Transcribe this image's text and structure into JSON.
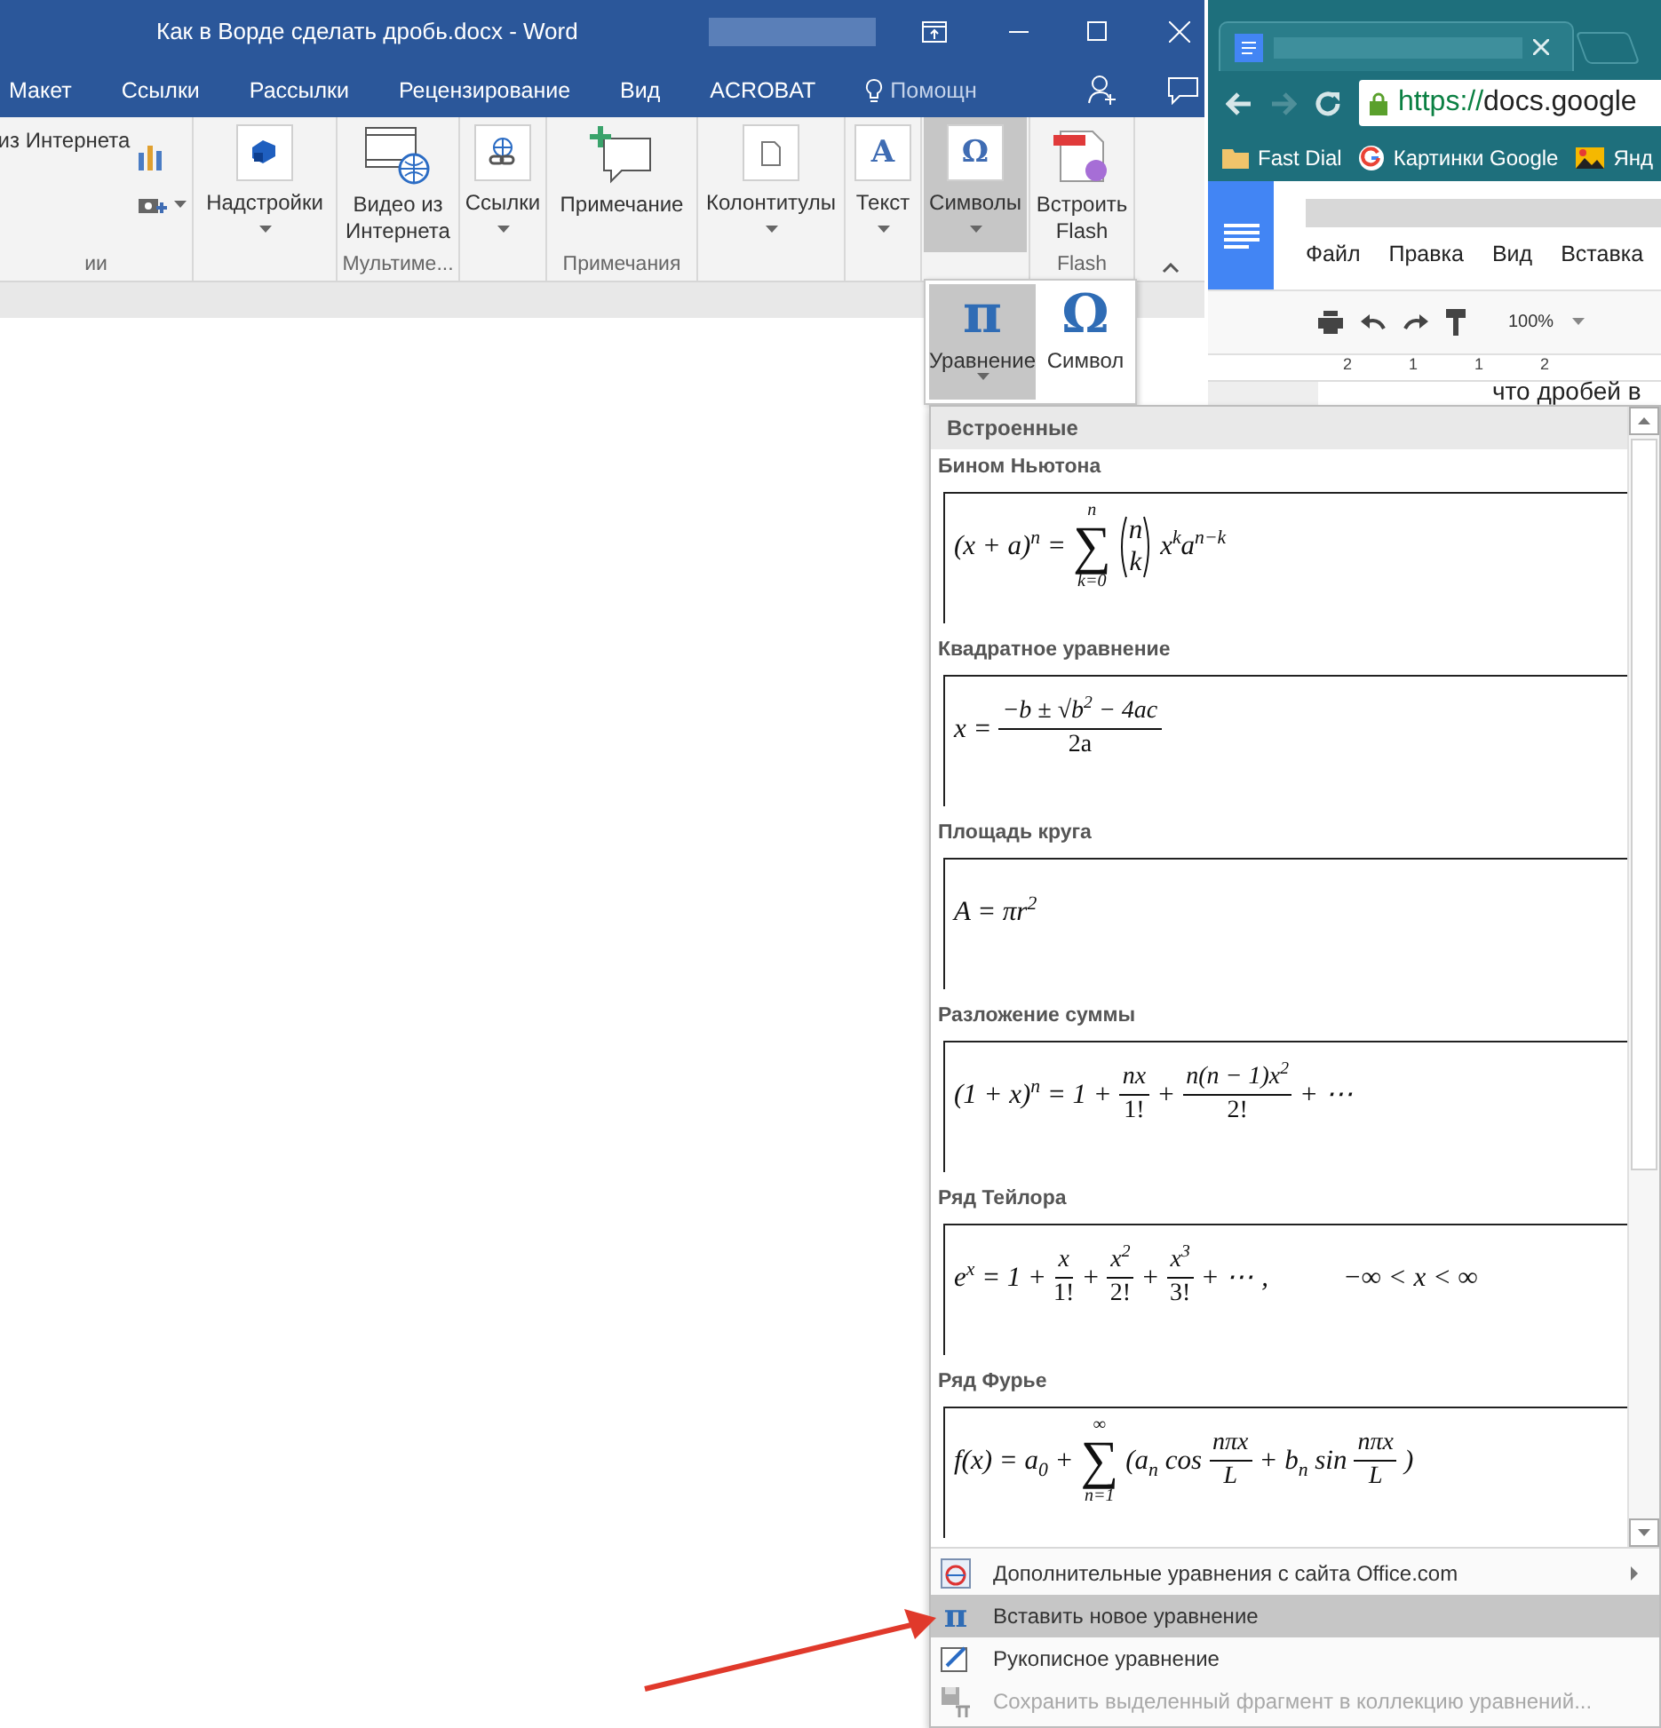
{
  "word": {
    "title": "Как в Ворде сделать дробь.docx - Word",
    "tabs": [
      {
        "label": "Макет"
      },
      {
        "label": "Ссылки"
      },
      {
        "label": "Рассылки"
      },
      {
        "label": "Рецензирование"
      },
      {
        "label": "Вид"
      },
      {
        "label": "ACROBAT"
      }
    ],
    "tell_me": "Помощн",
    "ribbon_groups": [
      {
        "label": "ии",
        "buttons": [
          {
            "kind": "small",
            "label": "из Интернета"
          },
          {
            "kind": "icon"
          },
          {
            "kind": "icon",
            "dropdown": true
          }
        ]
      },
      {
        "buttons": [
          {
            "kind": "large",
            "label": "Надстройки",
            "dropdown": true,
            "pressed": false
          }
        ]
      },
      {
        "label": "Мультиме...",
        "buttons": [
          {
            "kind": "large",
            "label": "Видео из Интернета",
            "dropdown": false,
            "pressed": false
          }
        ]
      },
      {
        "buttons": [
          {
            "kind": "large",
            "label": "Ссылки",
            "dropdown": true,
            "pressed": false
          }
        ]
      },
      {
        "label": "Примечания",
        "buttons": [
          {
            "kind": "large",
            "label": "Примечание",
            "dropdown": false,
            "pressed": false
          }
        ]
      },
      {
        "buttons": [
          {
            "kind": "large",
            "label": "Колонтитулы",
            "dropdown": true,
            "pressed": false
          }
        ]
      },
      {
        "buttons": [
          {
            "kind": "large",
            "glyph": "A",
            "label": "Текст",
            "dropdown": true,
            "pressed": false
          }
        ]
      },
      {
        "buttons": [
          {
            "kind": "large",
            "glyph": "Ω",
            "label": "Символы",
            "dropdown": true,
            "pressed": true
          }
        ]
      },
      {
        "label": "Flash",
        "buttons": [
          {
            "kind": "large",
            "label": "Встроить Flash",
            "dropdown": false,
            "pressed": false
          }
        ]
      }
    ],
    "symbols_panel": [
      {
        "glyph": "π",
        "label": "Уравнение",
        "dropdown": true,
        "selected": true
      },
      {
        "glyph": "Ω",
        "label": "Символ",
        "dropdown": false,
        "selected": false
      }
    ],
    "gallery": {
      "header": "Встроенные",
      "items": [
        {
          "title": "Бином Ньютона",
          "equation": [
            {
              "kind": "text",
              "text": "(x + a)$^{n}$ ="
            },
            {
              "kind": "sum",
              "symbol": "∑",
              "upper": "n",
              "lower": "k=0"
            },
            {
              "kind": "binom",
              "top": "n",
              "bottom": "k"
            },
            {
              "kind": "text",
              "text": "x$^{k}$a$^{n−k}$"
            }
          ]
        },
        {
          "title": "Квадратное уравнение",
          "equation": [
            {
              "kind": "text",
              "text": "x ="
            },
            {
              "kind": "frac",
              "num": "−b ± √b$^{2}$ − 4ac",
              "den": "2a"
            }
          ]
        },
        {
          "title": "Площадь круга",
          "equation": [
            {
              "kind": "text",
              "text": "A = πr$^{2}$"
            }
          ]
        },
        {
          "title": "Разложение суммы",
          "equation": [
            {
              "kind": "text",
              "text": "(1 + x)$^{n}$ = 1 +"
            },
            {
              "kind": "frac",
              "num": "nx",
              "den": "1!"
            },
            {
              "kind": "text",
              "text": "+"
            },
            {
              "kind": "frac",
              "num": "n(n − 1)x$^{2}$",
              "den": "2!"
            },
            {
              "kind": "text",
              "text": "+ ⋯"
            }
          ]
        },
        {
          "title": "Ряд Тейлора",
          "equation": [
            {
              "kind": "text",
              "text": "e$^{x}$ = 1 +"
            },
            {
              "kind": "frac",
              "num": "x",
              "den": "1!"
            },
            {
              "kind": "text",
              "text": "+"
            },
            {
              "kind": "frac",
              "num": "x$^{2}$",
              "den": "2!"
            },
            {
              "kind": "text",
              "text": "+"
            },
            {
              "kind": "frac",
              "num": "x$^{3}$",
              "den": "3!"
            },
            {
              "kind": "text",
              "text": "+ ⋯ ,"
            },
            {
              "kind": "space"
            },
            {
              "kind": "text",
              "text": "−∞ < x < ∞"
            }
          ]
        },
        {
          "title": "Ряд Фурье",
          "equation": [
            {
              "kind": "text",
              "text": "f(x) = a$_{0}$ +"
            },
            {
              "kind": "sum",
              "symbol": "∑",
              "upper": "∞",
              "lower": "n=1"
            },
            {
              "kind": "text",
              "text": "(a$_{n}$ cos"
            },
            {
              "kind": "frac",
              "num": "nπx",
              "den": "L"
            },
            {
              "kind": "text",
              "text": "+ b$_{n}$ sin"
            },
            {
              "kind": "frac",
              "num": "nπx",
              "den": "L"
            },
            {
              "kind": "text",
              "text": ")"
            }
          ]
        }
      ]
    },
    "menu": [
      {
        "kind": "office",
        "label": "Дополнительные уравнения с сайта Office.com",
        "submenu": true,
        "selected": false,
        "disabled": false
      },
      {
        "kind": "insert",
        "glyph": "π",
        "label": "Вставить новое уравнение",
        "submenu": false,
        "selected": true,
        "disabled": false
      },
      {
        "kind": "ink",
        "label": "Рукописное уравнение",
        "submenu": false,
        "selected": false,
        "disabled": false
      },
      {
        "kind": "save",
        "label": "Сохранить выделенный фрагмент в коллекцию уравнений...",
        "submenu": false,
        "selected": false,
        "disabled": true
      }
    ]
  },
  "browser": {
    "address": {
      "scheme": "https://",
      "host": "docs.google"
    },
    "bookmarks": [
      {
        "kind": "folder",
        "label": "Fast Dial"
      },
      {
        "kind": "google",
        "label": "Картинки Google"
      },
      {
        "kind": "image",
        "label": "Янд"
      }
    ],
    "docs_menu": [
      "Файл",
      "Правка",
      "Вид",
      "Вставка"
    ],
    "zoom": "100%",
    "ruler": [
      "2",
      "1",
      "1",
      "2"
    ],
    "doc_text": "что дробей в"
  }
}
